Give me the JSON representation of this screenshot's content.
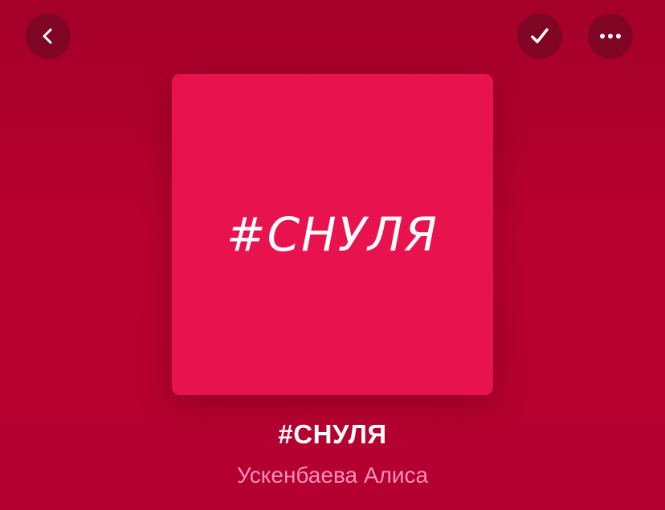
{
  "header": {
    "back_icon": "chevron-left-icon",
    "check_icon": "checkmark-icon",
    "more_icon": "ellipsis-icon"
  },
  "album": {
    "cover_text": "#СНУЛЯ",
    "cover_color": "#e8124f",
    "title": "#СНУЛЯ",
    "artist": "Ускенбаева Алиса"
  },
  "colors": {
    "background": "#b8002f",
    "artist_text": "#ff8fb8",
    "button_bg": "#5c0a1e"
  }
}
